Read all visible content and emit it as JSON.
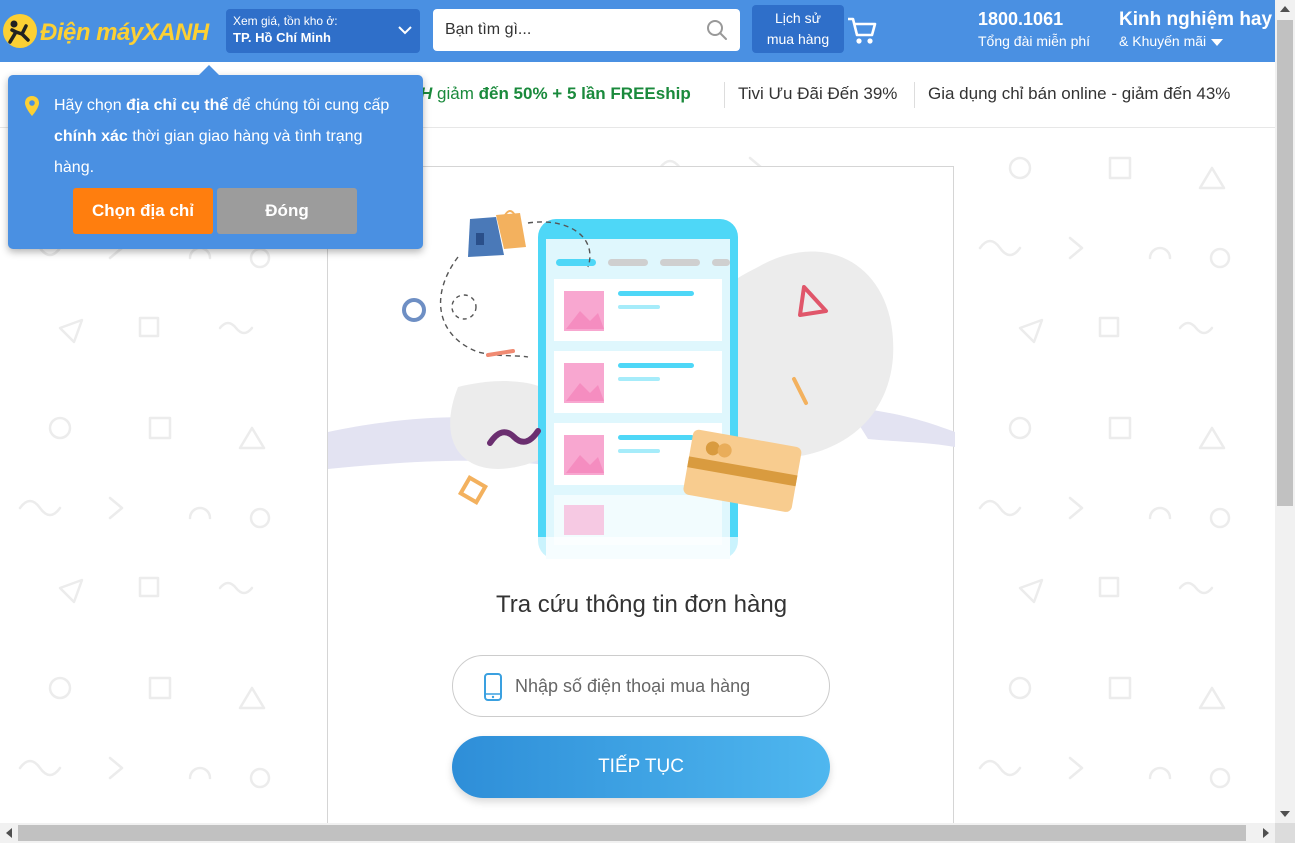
{
  "header": {
    "logo_text_1": "Điện máy",
    "logo_text_2": "XANH",
    "location_label": "Xem giá, tồn kho ở:",
    "location_value": "TP. Hồ Chí Minh",
    "search_placeholder": "Bạn tìm gì...",
    "history_line1": "Lịch sử",
    "history_line2": "mua hàng",
    "hotline_number": "1800.1061",
    "hotline_label": "Tổng đài miễn phí",
    "promo_title": "Kinh nghiệm hay",
    "promo_sub": "& Khuyến mãi",
    "brand_color": "#4a90e2",
    "logo_color": "#fcd034"
  },
  "strip": {
    "brand_tail": "H",
    "promo1_prefix": "giảm",
    "promo1_bold": "đến 50% + 5 lần FREEship",
    "promo2": "Tivi Ưu Đãi Đến 39%",
    "promo3": "Gia dụng chỉ bán online - giảm đến 43%"
  },
  "tooltip": {
    "msg_1": "Hãy chọn ",
    "msg_bold_1": "địa chỉ cụ thể",
    "msg_2": " để chúng tôi cung cấp ",
    "msg_bold_2": "chính xác",
    "msg_3": " thời gian giao hàng và tình trạng hàng.",
    "choose_button": "Chọn địa chỉ",
    "close_button": "Đóng",
    "choose_color": "#ff7e0e"
  },
  "main": {
    "title": "Tra cứu thông tin đơn hàng",
    "phone_placeholder": "Nhập số điện thoại mua hàng",
    "continue_button": "TIẾP TỤC"
  }
}
